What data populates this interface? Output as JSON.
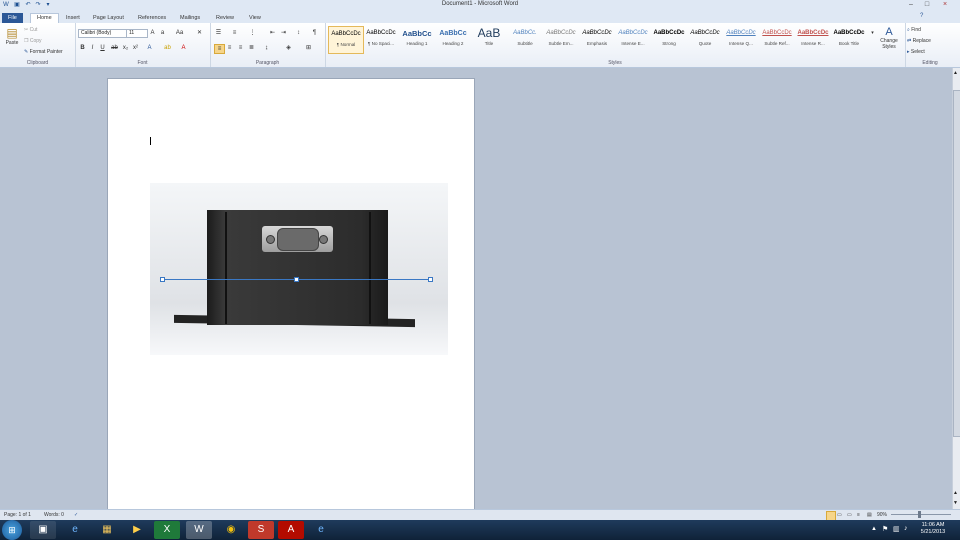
{
  "window": {
    "title": "Document1 - Microsoft Word",
    "minimize": "–",
    "maximize": "□",
    "close": "×"
  },
  "tabs": [
    {
      "label": "File"
    },
    {
      "label": "Home"
    },
    {
      "label": "Insert"
    },
    {
      "label": "Page Layout"
    },
    {
      "label": "References"
    },
    {
      "label": "Mailings"
    },
    {
      "label": "Review"
    },
    {
      "label": "View"
    }
  ],
  "clipboard": {
    "paste": "Paste",
    "cut": "Cut",
    "copy": "Copy",
    "format_painter": "Format Painter",
    "label": "Clipboard"
  },
  "font": {
    "name": "Calibri (Body)",
    "size": "11",
    "label": "Font"
  },
  "paragraph": {
    "label": "Paragraph"
  },
  "styles": {
    "label": "Styles",
    "items": [
      {
        "sample": "AaBbCcDc",
        "name": "¶ Normal"
      },
      {
        "sample": "AaBbCcDc",
        "name": "¶ No Spaci..."
      },
      {
        "sample": "AaBbCc",
        "name": "Heading 1"
      },
      {
        "sample": "AaBbCc",
        "name": "Heading 2"
      },
      {
        "sample": "AaB",
        "name": "Title"
      },
      {
        "sample": "AaBbCc.",
        "name": "Subtitle"
      },
      {
        "sample": "AaBbCcDc",
        "name": "Subtle Em..."
      },
      {
        "sample": "AaBbCcDc",
        "name": "Emphasis"
      },
      {
        "sample": "AaBbCcDc",
        "name": "Intense E..."
      },
      {
        "sample": "AaBbCcDc",
        "name": "Strong"
      },
      {
        "sample": "AaBbCcDc",
        "name": "Quote"
      },
      {
        "sample": "AaBbCcDc",
        "name": "Intense Q..."
      },
      {
        "sample": "AaBbCcDc",
        "name": "Subtle Ref..."
      },
      {
        "sample": "AaBbCcDc",
        "name": "Intense R..."
      },
      {
        "sample": "AaBbCcDc",
        "name": "Book Title"
      }
    ],
    "change_styles": "Change Styles"
  },
  "editing": {
    "find": "Find",
    "replace": "Replace",
    "select": "Select",
    "label": "Editing"
  },
  "status": {
    "page": "Page: 1 of 1",
    "words": "Words: 0",
    "zoom": "90%"
  },
  "clock": {
    "time": "11:06 AM",
    "date": "5/21/2013"
  }
}
